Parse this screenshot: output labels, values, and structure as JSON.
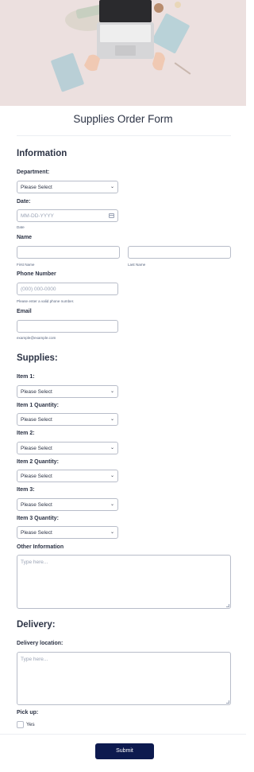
{
  "form": {
    "title": "Supplies Order Form",
    "submit_label": "Submit"
  },
  "sections": {
    "information": "Information",
    "supplies": "Supplies:",
    "delivery": "Delivery:"
  },
  "information": {
    "department_label": "Department:",
    "department_value": "Please Select",
    "date_label": "Date:",
    "date_placeholder": "MM-DD-YYYY",
    "date_sublabel": "Date",
    "name_label": "Name",
    "first_name_sublabel": "First Name",
    "last_name_sublabel": "Last Name",
    "phone_label": "Phone Number",
    "phone_placeholder": "(000) 000-0000",
    "phone_sublabel": "Please enter a valid phone number.",
    "email_label": "Email",
    "email_sublabel": "example@example.com"
  },
  "supplies": {
    "item1_label": "Item 1:",
    "item1_value": "Please Select",
    "item1_qty_label": "Item 1 Quantity:",
    "item1_qty_value": "Please Select",
    "item2_label": "Item 2:",
    "item2_value": "Please Select",
    "item2_qty_label": "Item 2 Quantity:",
    "item2_qty_value": "Please Select",
    "item3_label": "Item 3:",
    "item3_value": "Please Select",
    "item3_qty_label": "Item 3 Quantity:",
    "item3_qty_value": "Please Select",
    "other_label": "Other Information",
    "other_placeholder": "Type here..."
  },
  "delivery": {
    "location_label": "Delivery location:",
    "location_placeholder": "Type here...",
    "pickup_label": "Pick up:",
    "pickup_option": "Yes"
  },
  "icons": {
    "select": "chevron-down-icon",
    "date": "calendar-icon",
    "resize": "resize-grip-icon"
  },
  "colors": {
    "submit_bg": "#0d1a4f",
    "hero_bg": "#ece0df",
    "text": "#2c3345"
  }
}
